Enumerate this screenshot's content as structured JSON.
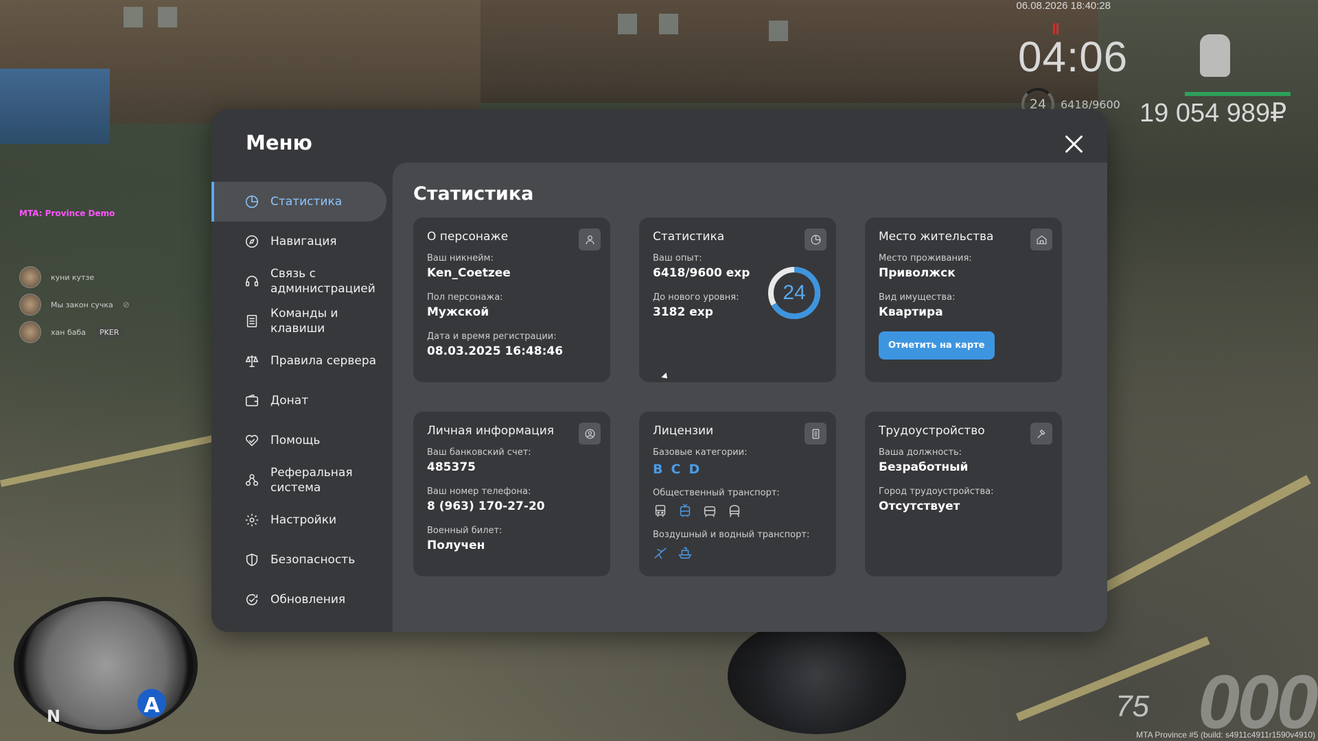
{
  "hud": {
    "date": "06.08.2026 18:40:28",
    "time": "04:06",
    "level": "24",
    "exp": "6418/9600",
    "money": "19 054 989₽"
  },
  "chat": {
    "title": "MTA: Province Demo",
    "voice": [
      {
        "name": "куни кутзе",
        "badge": ""
      },
      {
        "name": "Мы закон сучка",
        "badge": ""
      },
      {
        "name": "хан баба",
        "badge": "PKER"
      }
    ]
  },
  "minimap": {
    "north": "N",
    "marker": "A"
  },
  "vehicle": {
    "speed": "000",
    "fuel": "75"
  },
  "build": "MTA Province #5 (build: s4911c4911r1590v4910)",
  "menu": {
    "title": "Меню",
    "nav": [
      {
        "label": "Статистика",
        "icon": "pie-chart-icon"
      },
      {
        "label": "Навигация",
        "icon": "compass-icon"
      },
      {
        "label": "Связь с администрацией",
        "icon": "headset-icon"
      },
      {
        "label": "Команды и клавиши",
        "icon": "document-list-icon"
      },
      {
        "label": "Правила сервера",
        "icon": "scales-icon"
      },
      {
        "label": "Донат",
        "icon": "wallet-icon"
      },
      {
        "label": "Помощь",
        "icon": "heart-hand-icon"
      },
      {
        "label": "Реферальная система",
        "icon": "users-network-icon"
      },
      {
        "label": "Настройки",
        "icon": "gear-icon"
      },
      {
        "label": "Безопасность",
        "icon": "shield-icon"
      },
      {
        "label": "Обновления",
        "icon": "refresh-check-icon"
      }
    ]
  },
  "content": {
    "title": "Статистика",
    "character": {
      "title": "О персонаже",
      "nickname_label": "Ваш никнейм:",
      "nickname": "Ken_Coetzee",
      "gender_label": "Пол персонажа:",
      "gender": "Мужской",
      "reg_label": "Дата и время регистрации:",
      "reg": "08.03.2025 16:48:46"
    },
    "stats": {
      "title": "Статистика",
      "exp_label": "Ваш опыт:",
      "exp": "6418/9600 exp",
      "next_label": "До нового уровня:",
      "next": "3182 exp",
      "level": "24",
      "progress": 0.6685
    },
    "residence": {
      "title": "Место жительства",
      "place_label": "Место проживания:",
      "place": "Приволжск",
      "type_label": "Вид имущества:",
      "type": "Квартира",
      "button": "Отметить на карте"
    },
    "personal": {
      "title": "Личная информация",
      "bank_label": "Ваш банковский счет:",
      "bank": "485375",
      "phone_label": "Ваш номер телефона:",
      "phone": "8 (963) 170-27-20",
      "military_label": "Военный билет:",
      "military": "Получен"
    },
    "licenses": {
      "title": "Лицензии",
      "base_label": "Базовые категории:",
      "categories": [
        "B",
        "C",
        "D"
      ],
      "public_label": "Общественный транспорт:",
      "public_icons": [
        "bus-icon",
        "trolleybus-icon",
        "tram-icon",
        "train-icon"
      ],
      "air_label": "Воздушный и водный транспорт:",
      "air_icons": [
        "airplane-icon",
        "boat-icon"
      ],
      "active_color": "#4b9be6",
      "inactive_color": "#cfcfcf"
    },
    "employment": {
      "title": "Трудоустройство",
      "position_label": "Ваша должность:",
      "position": "Безработный",
      "city_label": "Город трудоустройства:",
      "city": "Отсутствует"
    }
  },
  "colors": {
    "accent": "#5aa8ef",
    "button": "#3d95e0",
    "panel": "#37383b",
    "content": "#47494c"
  }
}
